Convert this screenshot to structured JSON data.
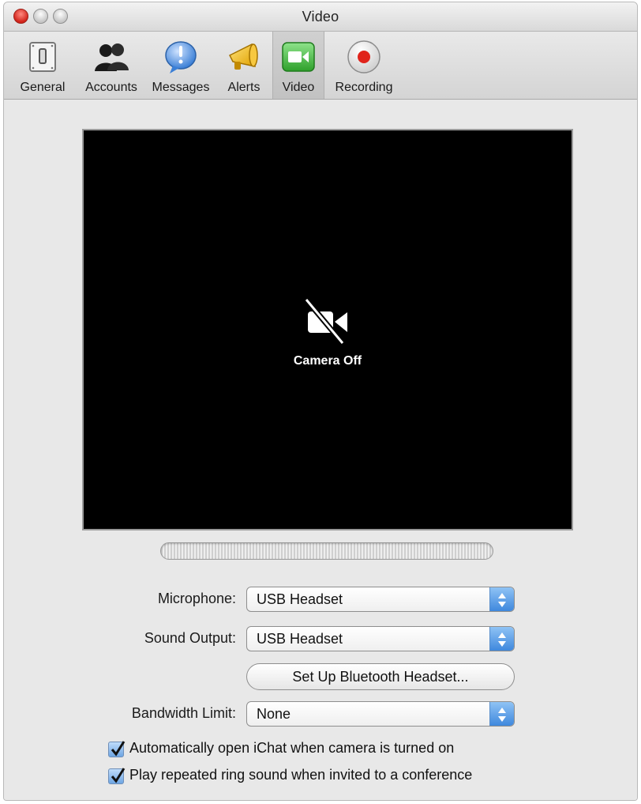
{
  "window": {
    "title": "Video"
  },
  "toolbar": {
    "items": [
      {
        "label": "General",
        "icon": "general-switch-icon"
      },
      {
        "label": "Accounts",
        "icon": "accounts-people-icon"
      },
      {
        "label": "Messages",
        "icon": "messages-bubble-icon"
      },
      {
        "label": "Alerts",
        "icon": "alerts-megaphone-icon"
      },
      {
        "label": "Video",
        "icon": "video-camera-icon",
        "selected": true
      },
      {
        "label": "Recording",
        "icon": "recording-icon"
      }
    ]
  },
  "preview": {
    "status_label": "Camera Off",
    "icon": "camera-off-icon"
  },
  "form": {
    "microphone_label": "Microphone:",
    "microphone_value": "USB Headset",
    "sound_output_label": "Sound Output:",
    "sound_output_value": "USB Headset",
    "bluetooth_button": "Set Up Bluetooth Headset...",
    "bandwidth_label": "Bandwidth Limit:",
    "bandwidth_value": "None"
  },
  "options": {
    "auto_open_label": "Automatically open iChat when camera is turned on",
    "auto_open_checked": true,
    "repeat_ring_label": "Play repeated ring sound when invited to a conference",
    "repeat_ring_checked": true
  },
  "colors": {
    "accent": "#4a90e2",
    "video_bg": "#000000",
    "close_red": "#d2231a"
  }
}
